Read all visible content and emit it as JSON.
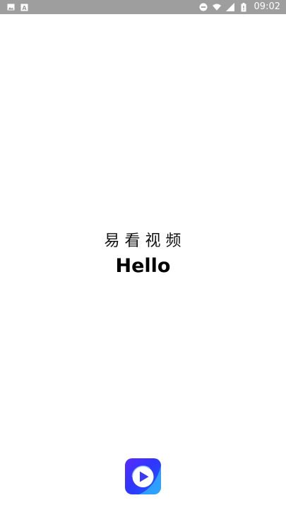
{
  "status_bar": {
    "left_icons": [
      "image-icon",
      "a-icon"
    ],
    "right_icons": [
      "do-not-disturb-icon",
      "wifi-icon",
      "signal-icon",
      "battery-icon"
    ],
    "time": "09:02",
    "background": "#9e9e9e"
  },
  "splash": {
    "title": "易看视频",
    "greeting": "Hello",
    "logo_icon": "play-logo-icon",
    "logo_colors": [
      "#5b2cff",
      "#1f5bff"
    ]
  }
}
